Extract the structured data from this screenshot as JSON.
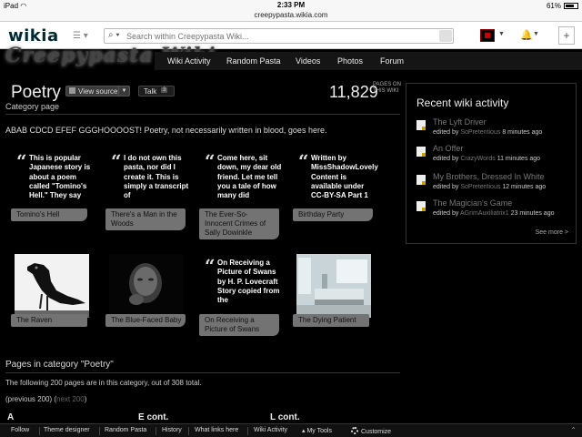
{
  "status": {
    "carrier": "iPad",
    "wifi_icon": "wifi-icon",
    "time": "2:33 PM",
    "battery": "61%"
  },
  "url": "creepypasta.wikia.com",
  "header": {
    "logo": "wikia",
    "hub_menu_icon": "hamburger-icon",
    "search_placeholder": "Search within Creepypasta Wiki...",
    "plus": "+"
  },
  "wiki": {
    "wordmark": "Creepypasta Wiki",
    "nav": [
      "Wiki Activity",
      "Random Pasta",
      "Videos",
      "Photos",
      "Forum"
    ]
  },
  "page": {
    "title": "Poetry",
    "view_source": "View source",
    "talk": "Talk",
    "talk_count": "3",
    "subtitle": "Category page",
    "count": "11,829",
    "count_label_1": "PAGES ON",
    "count_label_2": "THIS WIKI",
    "intro": "ABAB CDCD EFEF GGGHOOOOST! Poetry, not necessarily written in blood, goes here."
  },
  "gallery": [
    {
      "excerpt": "This is popular Japanese story is about a poem called \"Tomino's Hell.\" They say",
      "caption": "Tomino's Hell"
    },
    {
      "excerpt": "I do not own this pasta, nor did I create it. This is simply a transcript of",
      "caption": "There's a Man in the Woods"
    },
    {
      "excerpt": "Come here, sit down, my dear old friend. Let me tell you a tale of how many did",
      "caption": "The Ever-So-Innocent Crimes of Sally Dowinkle"
    },
    {
      "excerpt": "Written by MissShadowLovely Content is available under CC-BY-SA Part 1",
      "caption": "Birthday Party"
    },
    {
      "caption": "The Raven"
    },
    {
      "caption": "The Blue-Faced Baby"
    },
    {
      "excerpt": "On Receiving a Picture of Swans by H. P. Lovecraft Story copied from the",
      "caption": "On Receiving a Picture of Swans"
    },
    {
      "caption": "The Dying Patient"
    }
  ],
  "category": {
    "heading": "Pages in category \"Poetry\"",
    "total": "The following 200 pages are in this category, out of 308 total.",
    "prev": "(previous 200)",
    "next": "next 200",
    "columns": [
      "A",
      "E cont.",
      "L cont."
    ]
  },
  "rail": {
    "title": "Recent wiki activity",
    "items": [
      {
        "title": "The Lyft Driver",
        "by": "edited by",
        "user": "SoPretentious",
        "when": "8 minutes ago"
      },
      {
        "title": "An Offer",
        "by": "edited by",
        "user": "CrazyWords",
        "when": "11 minutes ago"
      },
      {
        "title": "My Brothers, Dressed In White",
        "by": "edited by",
        "user": "SoPretentious",
        "when": "12 minutes ago"
      },
      {
        "title": "The Magician's Game",
        "by": "edited by",
        "user": "AGrimAuxiliatrix1",
        "when": "23 minutes ago"
      }
    ],
    "see_more": "See more >"
  },
  "toolbar": [
    "Follow",
    "Theme designer",
    "Random Pasta",
    "History",
    "What links here",
    "Wiki Activity",
    "My Tools",
    "Customize"
  ]
}
